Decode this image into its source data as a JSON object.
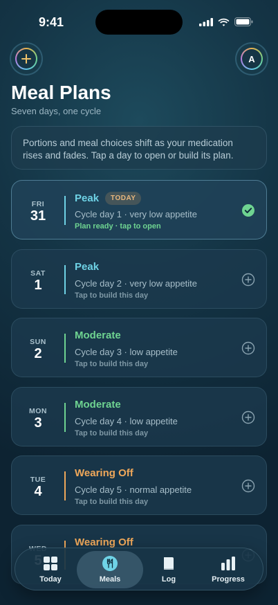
{
  "status": {
    "time": "9:41"
  },
  "header": {
    "avatar_initial": "A",
    "title": "Meal Plans",
    "subtitle": "Seven days, one cycle"
  },
  "info": {
    "text": "Portions and meal choices shift as your medication rises and fades. Tap a day to open or build its plan."
  },
  "colors": {
    "peak": "#6fd3e6",
    "moderate": "#6fd491",
    "wearing_off": "#f0a85a",
    "ready": "#6fd491"
  },
  "days": [
    {
      "dow": "FRI",
      "num": "31",
      "phase": "Peak",
      "badge": "TODAY",
      "detail": "Cycle day 1 · very low appetite",
      "hint": "Plan ready · tap to open",
      "action_icon": "check-circle-icon"
    },
    {
      "dow": "SAT",
      "num": "1",
      "phase": "Peak",
      "badge": "",
      "detail": "Cycle day 2 · very low appetite",
      "hint": "Tap to build this day",
      "action_icon": "plus-circle-icon"
    },
    {
      "dow": "SUN",
      "num": "2",
      "phase": "Moderate",
      "badge": "",
      "detail": "Cycle day 3 · low appetite",
      "hint": "Tap to build this day",
      "action_icon": "plus-circle-icon"
    },
    {
      "dow": "MON",
      "num": "3",
      "phase": "Moderate",
      "badge": "",
      "detail": "Cycle day 4 · low appetite",
      "hint": "Tap to build this day",
      "action_icon": "plus-circle-icon"
    },
    {
      "dow": "TUE",
      "num": "4",
      "phase": "Wearing Off",
      "badge": "",
      "detail": "Cycle day 5 · normal appetite",
      "hint": "Tap to build this day",
      "action_icon": "plus-circle-icon"
    },
    {
      "dow": "WED",
      "num": "5",
      "phase": "Wearing Off",
      "badge": "",
      "detail": "",
      "hint": "",
      "action_icon": "plus-circle-icon"
    }
  ],
  "tabs": [
    {
      "label": "Today",
      "icon": "grid-icon"
    },
    {
      "label": "Meals",
      "icon": "fork-knife-icon",
      "active": true
    },
    {
      "label": "Log",
      "icon": "book-icon"
    },
    {
      "label": "Progress",
      "icon": "bar-chart-icon"
    }
  ]
}
